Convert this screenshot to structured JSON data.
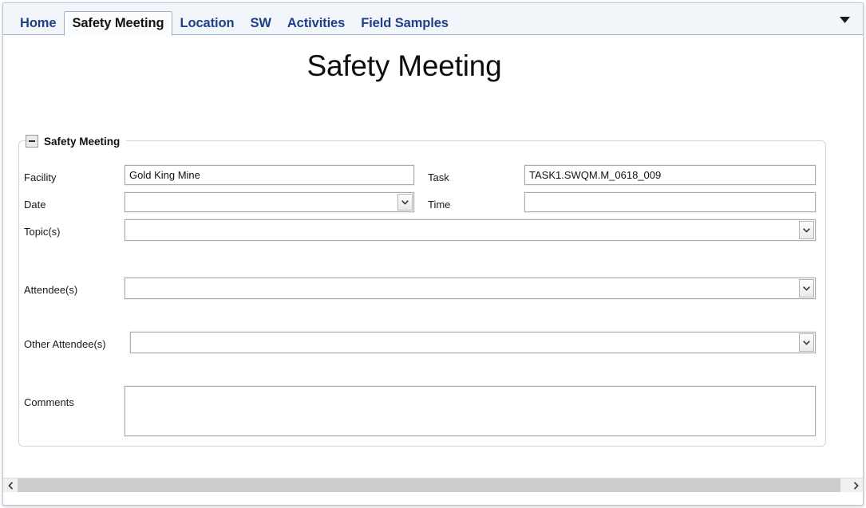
{
  "window": {
    "tabs": [
      {
        "label": "Home",
        "active": false
      },
      {
        "label": "Safety Meeting",
        "active": true
      },
      {
        "label": "Location",
        "active": false
      },
      {
        "label": "SW",
        "active": false
      },
      {
        "label": "Activities",
        "active": false
      },
      {
        "label": "Field Samples",
        "active": false
      }
    ],
    "overflow_icon": "chevron-down-icon"
  },
  "page": {
    "title": "Safety Meeting"
  },
  "group": {
    "title": "Safety Meeting",
    "collapse_icon": "minus-icon",
    "collapsed": false
  },
  "form": {
    "facility": {
      "label": "Facility",
      "value": "Gold King Mine",
      "placeholder": ""
    },
    "task": {
      "label": "Task",
      "value": "TASK1.SWQM.M_0618_009",
      "placeholder": ""
    },
    "date": {
      "label": "Date",
      "value": "",
      "placeholder": "",
      "dropdown_icon": "chevron-down-icon"
    },
    "time": {
      "label": "Time",
      "value": "",
      "placeholder": ""
    },
    "topics": {
      "label": "Topic(s)",
      "value": "",
      "placeholder": "",
      "dropdown_icon": "chevron-down-icon"
    },
    "attendees": {
      "label": "Attendee(s)",
      "value": "",
      "placeholder": "",
      "dropdown_icon": "chevron-down-icon"
    },
    "other_attendees": {
      "label": "Other Attendee(s)",
      "value": "",
      "placeholder": "",
      "dropdown_icon": "chevron-down-icon"
    },
    "comments": {
      "label": "Comments",
      "value": "",
      "placeholder": ""
    }
  },
  "scrollbar": {
    "left_icon": "chevron-left-icon",
    "right_icon": "chevron-right-icon"
  },
  "colors": {
    "tab_text": "#1f3f86",
    "active_tab_text": "#121212",
    "frame_border": "#b9c6d4",
    "control_border": "#ababab",
    "scroll_thumb": "#cdcdcd"
  }
}
